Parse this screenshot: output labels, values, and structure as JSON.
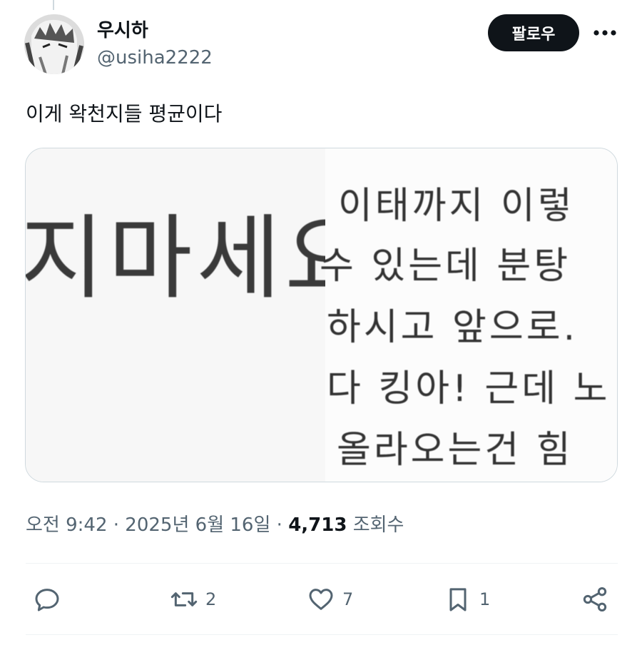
{
  "author": {
    "display_name": "우시하",
    "handle": "@usiha2222"
  },
  "follow_button_label": "팔로우",
  "more_icon": "more-horizontal-icon",
  "tweet": {
    "text": "이게 왁천지들 평균이다"
  },
  "media": {
    "left_text": "지마세요",
    "right_lines": [
      "이태까지 이렇",
      "수 있는데 분탕",
      "하시고 앞으로.",
      "다 킹아! 근데 노",
      "올라오는건 힘"
    ]
  },
  "meta": {
    "time": "오전 9:42",
    "separator": " · ",
    "date": "2025년 6월 16일",
    "views_count": "4,713",
    "views_label": "조회수"
  },
  "actions": {
    "reply": {
      "icon": "reply-icon",
      "count": ""
    },
    "retweet": {
      "icon": "retweet-icon",
      "count": "2"
    },
    "like": {
      "icon": "heart-icon",
      "count": "7"
    },
    "bookmark": {
      "icon": "bookmark-icon",
      "count": "1"
    },
    "share": {
      "icon": "share-icon",
      "count": ""
    }
  },
  "colors": {
    "text_primary": "#0f1419",
    "text_secondary": "#536471",
    "border": "#cfd9de",
    "follow_bg": "#0f1419"
  }
}
